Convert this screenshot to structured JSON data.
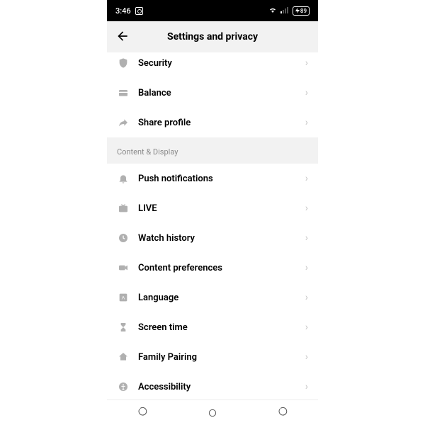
{
  "status": {
    "time": "3:46",
    "battery": "89"
  },
  "header": {
    "title": "Settings and privacy"
  },
  "sectionA": {
    "items": [
      {
        "label": "Security"
      },
      {
        "label": "Balance"
      },
      {
        "label": "Share profile"
      }
    ]
  },
  "sectionB": {
    "title": "Content & Display",
    "items": [
      {
        "label": "Push notifications"
      },
      {
        "label": "LIVE"
      },
      {
        "label": "Watch history"
      },
      {
        "label": "Content preferences"
      },
      {
        "label": "Language"
      },
      {
        "label": "Screen time"
      },
      {
        "label": "Family Pairing"
      },
      {
        "label": "Accessibility"
      }
    ]
  }
}
